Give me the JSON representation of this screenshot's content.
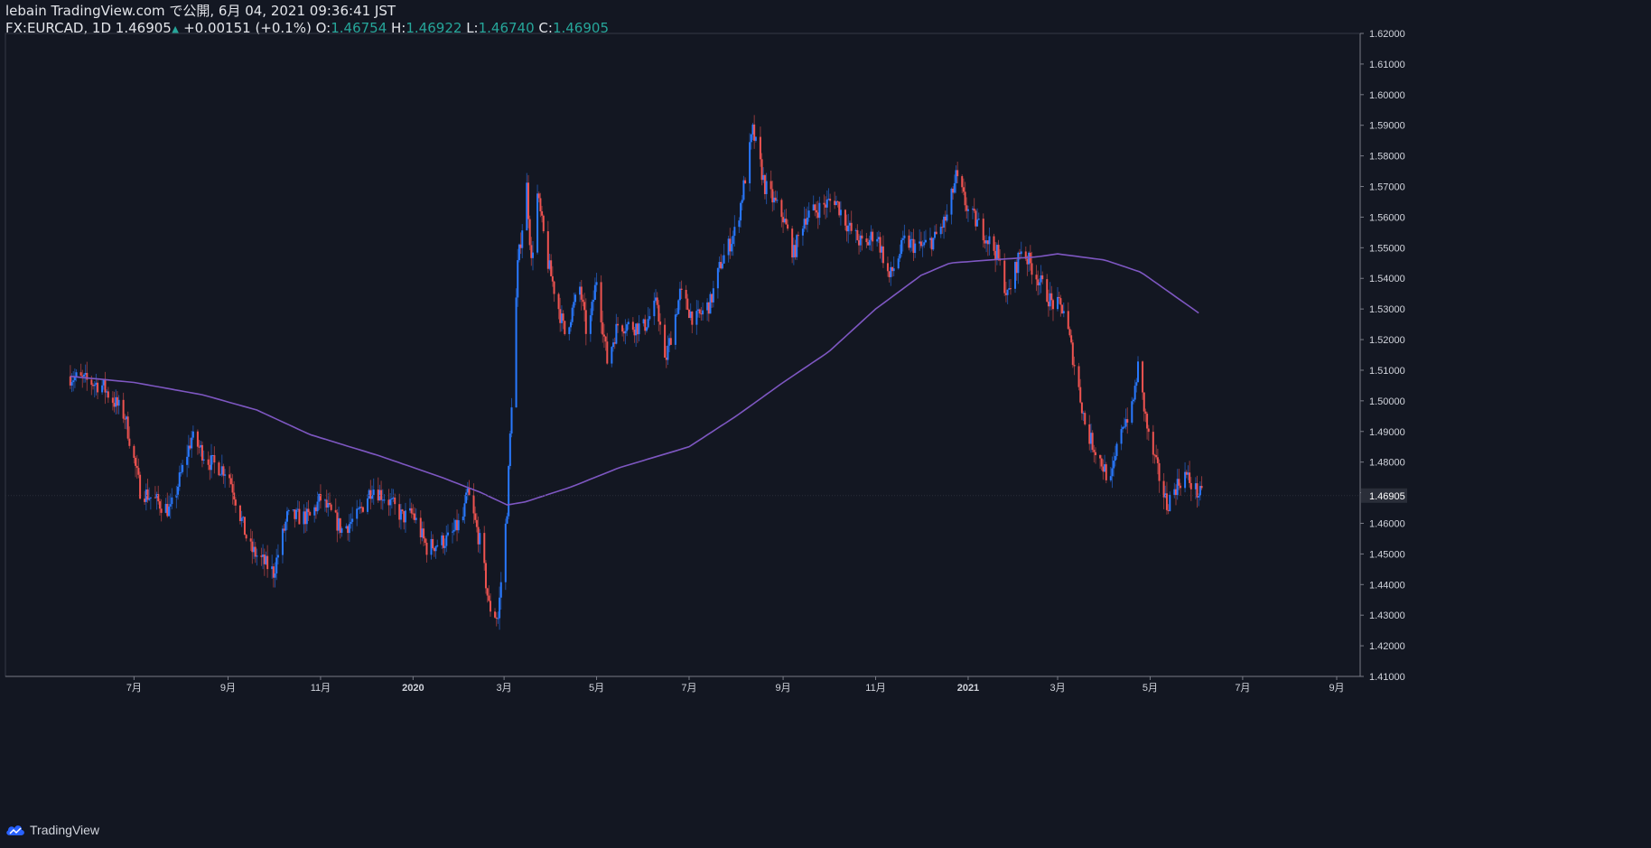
{
  "header": {
    "published": "lebain TradingView.com で公開, 6月 04, 2021 09:36:41 JST",
    "symbol": "FX:EURCAD, 1D",
    "last": "1.46905",
    "arrow": "▲",
    "change": "+0.00151 (+0.1%)",
    "o_label": "O:",
    "o": "1.46754",
    "h_label": "H:",
    "h": "1.46922",
    "l_label": "L:",
    "l": "1.46740",
    "c_label": "C:",
    "c": "1.46905"
  },
  "footer": {
    "brand": "TradingView"
  },
  "colors": {
    "background": "#131722",
    "up": "#2979ff",
    "down": "#ef5350",
    "ma": "#7e57c2",
    "grid": "#1c2030",
    "axis": "#787b86"
  },
  "chart_data": {
    "type": "candlestick",
    "symbol": "FX:EURCAD",
    "interval": "1D",
    "ylim": [
      1.41,
      1.62
    ],
    "y_ticks": [
      "1.41000",
      "1.42000",
      "1.43000",
      "1.44000",
      "1.45000",
      "1.46000",
      "1.47000",
      "1.48000",
      "1.49000",
      "1.50000",
      "1.51000",
      "1.52000",
      "1.53000",
      "1.54000",
      "1.55000",
      "1.56000",
      "1.57000",
      "1.58000",
      "1.59000",
      "1.60000",
      "1.61000",
      "1.62000"
    ],
    "x_ticks": [
      "7月",
      "9月",
      "11月",
      "2020",
      "3月",
      "5月",
      "7月",
      "9月",
      "11月",
      "2021",
      "3月",
      "5月",
      "7月",
      "9月"
    ],
    "last_price_label": "1.46905",
    "price_keypoints": [
      [
        "2019-05-20",
        1.508
      ],
      [
        "2019-06-10",
        1.505
      ],
      [
        "2019-06-25",
        1.495
      ],
      [
        "2019-07-05",
        1.471
      ],
      [
        "2019-07-25",
        1.464
      ],
      [
        "2019-08-08",
        1.488
      ],
      [
        "2019-08-20",
        1.48
      ],
      [
        "2019-09-01",
        1.477
      ],
      [
        "2019-09-15",
        1.452
      ],
      [
        "2019-10-01",
        1.444
      ],
      [
        "2019-10-10",
        1.462
      ],
      [
        "2019-10-25",
        1.462
      ],
      [
        "2019-11-01",
        1.468
      ],
      [
        "2019-11-15",
        1.458
      ],
      [
        "2019-11-25",
        1.462
      ],
      [
        "2019-12-05",
        1.472
      ],
      [
        "2019-12-15",
        1.468
      ],
      [
        "2019-12-25",
        1.462
      ],
      [
        "2020-01-01",
        1.463
      ],
      [
        "2020-01-10",
        1.452
      ],
      [
        "2020-01-25",
        1.455
      ],
      [
        "2020-02-03",
        1.462
      ],
      [
        "2020-02-06",
        1.47
      ],
      [
        "2020-02-15",
        1.452
      ],
      [
        "2020-02-20",
        1.433
      ],
      [
        "2020-02-26",
        1.429
      ],
      [
        "2020-03-03",
        1.465
      ],
      [
        "2020-03-06",
        1.5
      ],
      [
        "2020-03-10",
        1.544
      ],
      [
        "2020-03-16",
        1.57
      ],
      [
        "2020-03-19",
        1.545
      ],
      [
        "2020-03-23",
        1.567
      ],
      [
        "2020-03-30",
        1.545
      ],
      [
        "2020-04-10",
        1.522
      ],
      [
        "2020-04-20",
        1.537
      ],
      [
        "2020-04-25",
        1.52
      ],
      [
        "2020-05-01",
        1.54
      ],
      [
        "2020-05-08",
        1.513
      ],
      [
        "2020-05-15",
        1.525
      ],
      [
        "2020-06-01",
        1.524
      ],
      [
        "2020-06-10",
        1.532
      ],
      [
        "2020-06-15",
        1.512
      ],
      [
        "2020-06-25",
        1.535
      ],
      [
        "2020-07-05",
        1.526
      ],
      [
        "2020-07-15",
        1.532
      ],
      [
        "2020-07-22",
        1.545
      ],
      [
        "2020-08-01",
        1.556
      ],
      [
        "2020-08-06",
        1.57
      ],
      [
        "2020-08-12",
        1.588
      ],
      [
        "2020-08-20",
        1.57
      ],
      [
        "2020-09-01",
        1.56
      ],
      [
        "2020-09-08",
        1.548
      ],
      [
        "2020-09-15",
        1.56
      ],
      [
        "2020-09-25",
        1.563
      ],
      [
        "2020-10-05",
        1.566
      ],
      [
        "2020-10-15",
        1.556
      ],
      [
        "2020-10-25",
        1.55
      ],
      [
        "2020-11-01",
        1.556
      ],
      [
        "2020-11-10",
        1.54
      ],
      [
        "2020-11-20",
        1.552
      ],
      [
        "2020-12-01",
        1.55
      ],
      [
        "2020-12-10",
        1.553
      ],
      [
        "2020-12-18",
        1.56
      ],
      [
        "2020-12-24",
        1.573
      ],
      [
        "2021-01-01",
        1.562
      ],
      [
        "2021-01-10",
        1.556
      ],
      [
        "2021-01-20",
        1.548
      ],
      [
        "2021-01-27",
        1.534
      ],
      [
        "2021-02-05",
        1.55
      ],
      [
        "2021-02-15",
        1.541
      ],
      [
        "2021-02-25",
        1.532
      ],
      [
        "2021-03-05",
        1.53
      ],
      [
        "2021-03-12",
        1.512
      ],
      [
        "2021-03-20",
        1.49
      ],
      [
        "2021-03-28",
        1.482
      ],
      [
        "2021-04-05",
        1.473
      ],
      [
        "2021-04-12",
        1.492
      ],
      [
        "2021-04-19",
        1.497
      ],
      [
        "2021-04-23",
        1.511
      ],
      [
        "2021-04-30",
        1.488
      ],
      [
        "2021-05-07",
        1.475
      ],
      [
        "2021-05-12",
        1.466
      ],
      [
        "2021-05-18",
        1.472
      ],
      [
        "2021-05-24",
        1.476
      ],
      [
        "2021-06-01",
        1.47
      ],
      [
        "2021-06-04",
        1.469
      ]
    ],
    "ma_keypoints": [
      [
        "2019-05-20",
        1.508
      ],
      [
        "2019-07-01",
        1.506
      ],
      [
        "2019-08-15",
        1.502
      ],
      [
        "2019-09-20",
        1.497
      ],
      [
        "2019-10-25",
        1.489
      ],
      [
        "2019-12-10",
        1.482
      ],
      [
        "2020-01-20",
        1.475
      ],
      [
        "2020-02-15",
        1.47
      ],
      [
        "2020-03-03",
        1.466
      ],
      [
        "2020-03-15",
        1.467
      ],
      [
        "2020-04-15",
        1.472
      ],
      [
        "2020-05-15",
        1.478
      ],
      [
        "2020-07-01",
        1.485
      ],
      [
        "2020-08-01",
        1.495
      ],
      [
        "2020-09-01",
        1.506
      ],
      [
        "2020-10-01",
        1.516
      ],
      [
        "2020-11-01",
        1.53
      ],
      [
        "2020-12-01",
        1.541
      ],
      [
        "2020-12-20",
        1.545
      ],
      [
        "2021-01-15",
        1.546
      ],
      [
        "2021-02-15",
        1.547
      ],
      [
        "2021-03-01",
        1.548
      ],
      [
        "2021-04-01",
        1.546
      ],
      [
        "2021-04-25",
        1.542
      ],
      [
        "2021-05-15",
        1.535
      ],
      [
        "2021-06-04",
        1.528
      ]
    ]
  }
}
